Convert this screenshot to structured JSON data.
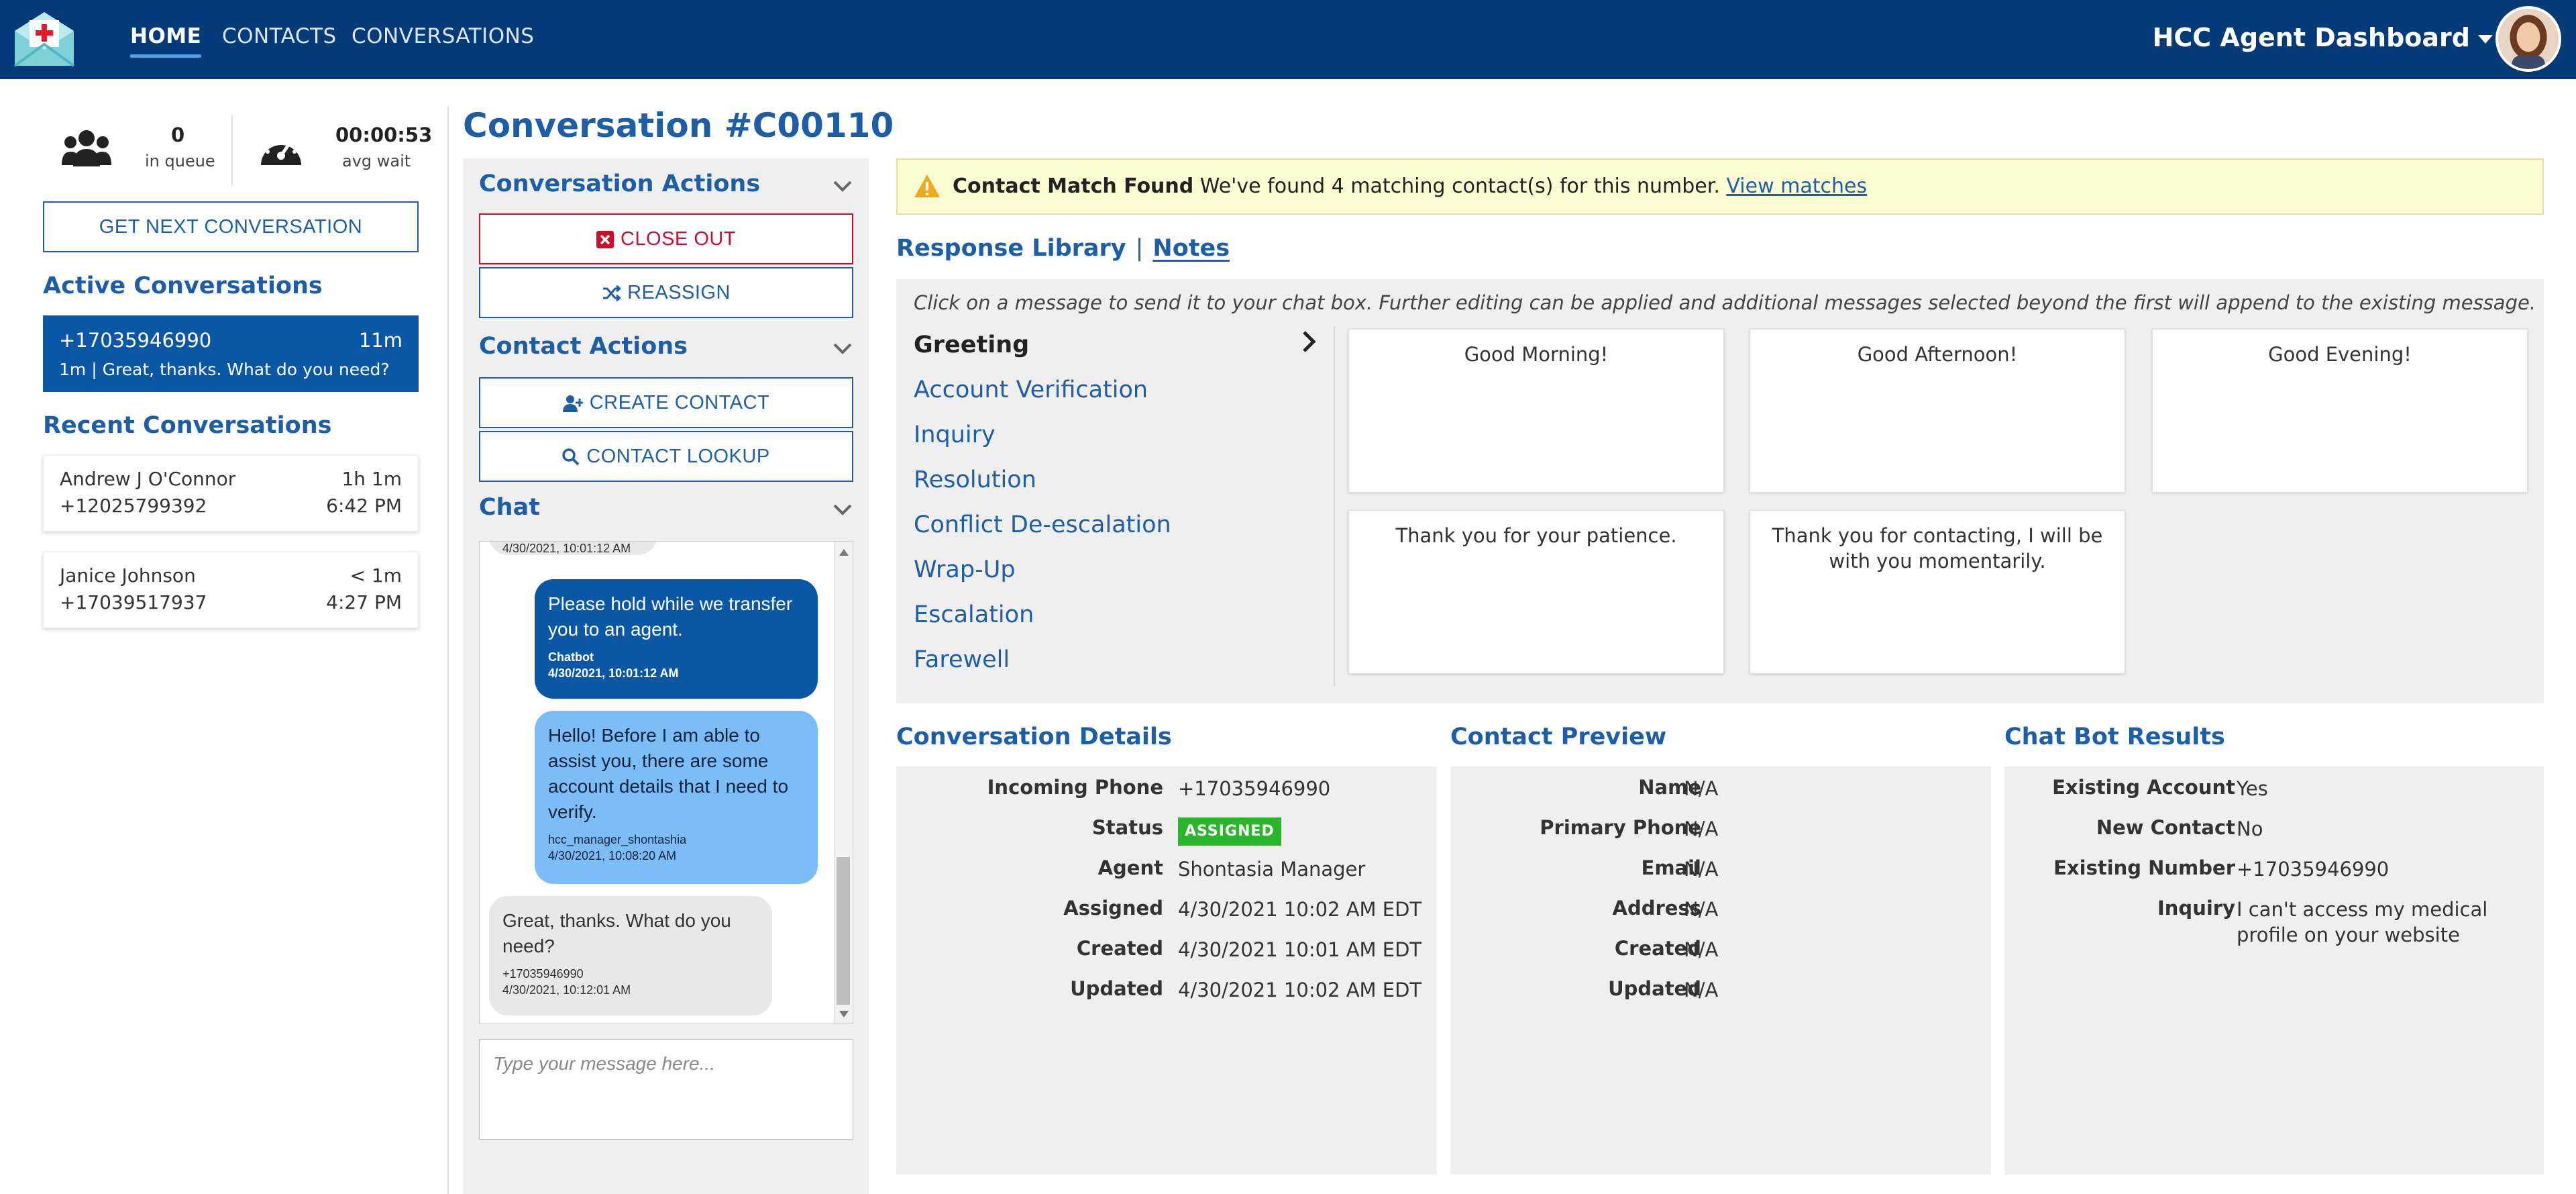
{
  "nav": {
    "links": [
      "HOME",
      "CONTACTS",
      "CONVERSATIONS"
    ],
    "dashboard_title": "HCC Agent Dashboard",
    "icons": {
      "logo": "medical-envelope-icon",
      "dropdown": "caret-down-icon",
      "avatar": "user-avatar"
    }
  },
  "stats": {
    "queue_count": "0",
    "queue_label": "in queue",
    "avg_wait": "00:00:53",
    "avg_wait_label": "avg wait"
  },
  "left": {
    "next_button": "GET NEXT CONVERSATION",
    "active_heading": "Active Conversations",
    "active": {
      "phone": "+17035946990",
      "age": "11m",
      "preview": "1m | Great, thanks. What do you need?"
    },
    "recent_heading": "Recent Conversations",
    "recent": [
      {
        "name": "Andrew J O'Connor",
        "age": "1h 1m",
        "phone": "+12025799392",
        "time": "6:42 PM"
      },
      {
        "name": "Janice Johnson",
        "age": "< 1m",
        "phone": "+17039517937",
        "time": "4:27 PM"
      }
    ]
  },
  "conversation": {
    "title": "Conversation #C00110",
    "actions_heading": "Conversation Actions",
    "close_out": "CLOSE OUT",
    "reassign": "REASSIGN",
    "contact_heading": "Contact Actions",
    "create_contact": "CREATE CONTACT",
    "contact_lookup": "CONTACT LOOKUP",
    "chat_heading": "Chat",
    "chat": [
      {
        "from": "user",
        "text": "",
        "sender": "",
        "time": "4/30/2021, 10:01:12 AM"
      },
      {
        "from": "bot",
        "text": "Please hold while we transfer you to an agent.",
        "sender": "Chatbot",
        "time": "4/30/2021, 10:01:12 AM"
      },
      {
        "from": "agent",
        "text": "Hello! Before I am able to assist you, there are some account details that I need to verify.",
        "sender": "hcc_manager_shontashia",
        "time": "4/30/2021, 10:08:20 AM"
      },
      {
        "from": "user",
        "text": "Great, thanks. What do you need?",
        "sender": "+17035946990",
        "time": "4/30/2021, 10:12:01 AM"
      }
    ],
    "message_placeholder": "Type your message here..."
  },
  "alert": {
    "title": "Contact Match Found",
    "text": "We've found 4 matching contact(s) for this number.",
    "link": "View matches",
    "color": "#fcfbd2"
  },
  "tabs": {
    "response_library": "Response Library",
    "separator": "|",
    "notes": "Notes"
  },
  "responses": {
    "hint": "Click on a message to send it to your chat box. Further editing can be applied and additional messages selected beyond the first will append to the existing message.",
    "categories": [
      "Greeting",
      "Account Verification",
      "Inquiry",
      "Resolution",
      "Conflict De-escalation",
      "Wrap-Up",
      "Escalation",
      "Farewell"
    ],
    "selected_category": "Greeting",
    "messages": [
      "Good Morning!",
      "Good Afternoon!",
      "Good Evening!",
      "Thank you for your patience.",
      "Thank you for contacting, I will be with you momentarily."
    ]
  },
  "details": {
    "heading": "Conversation Details",
    "rows": [
      {
        "label": "Incoming Phone",
        "value": "+17035946990"
      },
      {
        "label": "Status",
        "value": "ASSIGNED"
      },
      {
        "label": "Agent",
        "value": "Shontasia Manager"
      },
      {
        "label": "Assigned",
        "value": "4/30/2021 10:02 AM EDT"
      },
      {
        "label": "Created",
        "value": "4/30/2021 10:01 AM EDT"
      },
      {
        "label": "Updated",
        "value": "4/30/2021 10:02 AM EDT"
      }
    ]
  },
  "contact_preview": {
    "heading": "Contact Preview",
    "rows": [
      {
        "label": "Name",
        "value": "N/A"
      },
      {
        "label": "Primary Phone",
        "value": "N/A"
      },
      {
        "label": "Email",
        "value": "N/A"
      },
      {
        "label": "Address",
        "value": "N/A"
      },
      {
        "label": "Created",
        "value": "N/A"
      },
      {
        "label": "Updated",
        "value": "N/A"
      }
    ]
  },
  "bot_results": {
    "heading": "Chat Bot Results",
    "rows": [
      {
        "label": "Existing Account",
        "value": "Yes"
      },
      {
        "label": "New Contact",
        "value": "No"
      },
      {
        "label": "Existing Number",
        "value": "+17035946990"
      },
      {
        "label": "Inquiry",
        "value": "I can't access my medical profile on your website"
      }
    ]
  },
  "colors": {
    "navy": "#053a78",
    "accent": "#1e5ea6",
    "danger": "#c8102e",
    "success": "#2bb52b",
    "agent_bubble": "#7dbdf7"
  }
}
